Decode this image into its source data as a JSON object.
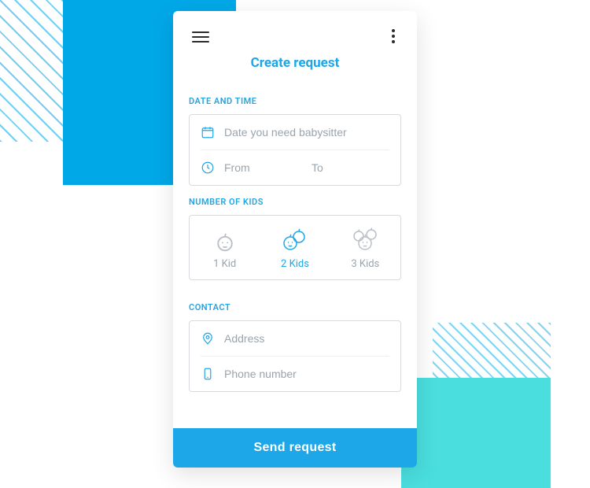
{
  "colors": {
    "brand": "#1ea7e8",
    "accent": "#4adede",
    "muted": "#9aa4ad",
    "border": "#d7dbdf"
  },
  "header": {
    "title": "Create request"
  },
  "sections": {
    "datetime": {
      "label": "DATE AND TIME",
      "date_placeholder": "Date you need babysitter",
      "from_placeholder": "From",
      "to_placeholder": "To"
    },
    "kids": {
      "label": "NUMBER OF KIDS",
      "options": [
        {
          "label": "1 Kid",
          "selected": false
        },
        {
          "label": "2 Kids",
          "selected": true
        },
        {
          "label": "3 Kids",
          "selected": false
        }
      ]
    },
    "contact": {
      "label": "CONTACT",
      "address_placeholder": "Address",
      "phone_placeholder": "Phone number"
    }
  },
  "footer": {
    "send_label": "Send request"
  }
}
